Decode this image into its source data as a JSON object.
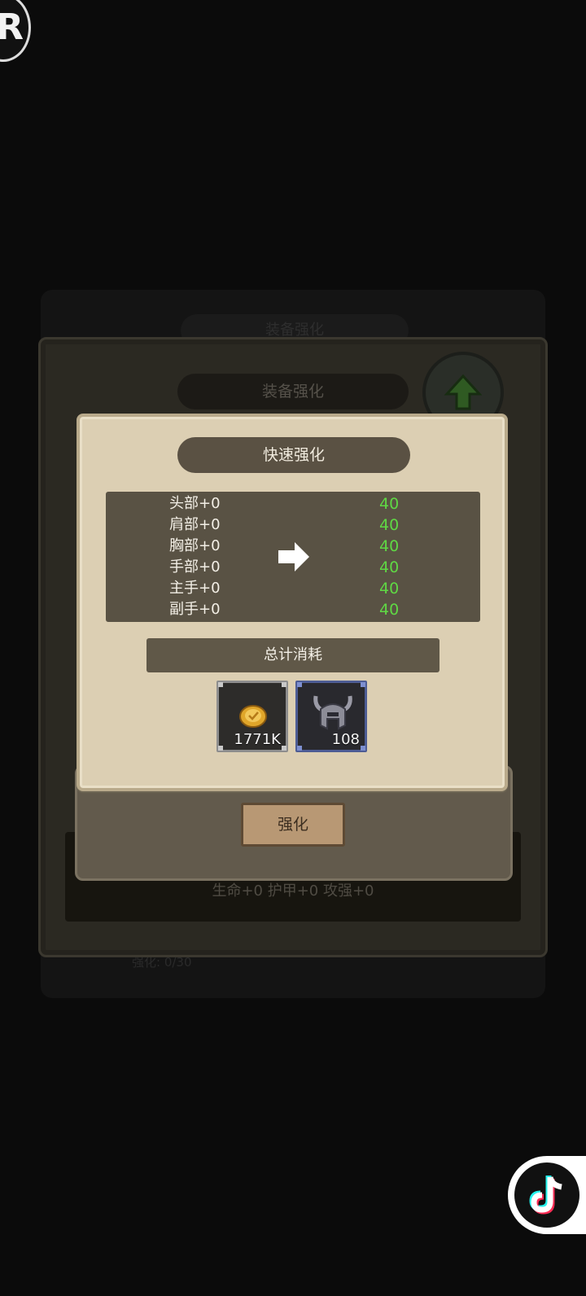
{
  "background_panel": {
    "title": "装备强化",
    "footer_text": "强化: 0/30"
  },
  "outer_panel": {
    "title": "装备强化",
    "stats": "生命+0  护甲+0  攻强+0"
  },
  "dialog": {
    "title": "快速强化",
    "items": [
      {
        "label": "头部+0",
        "value": "40"
      },
      {
        "label": "肩部+0",
        "value": "40"
      },
      {
        "label": "胸部+0",
        "value": "40"
      },
      {
        "label": "手部+0",
        "value": "40"
      },
      {
        "label": "主手+0",
        "value": "40"
      },
      {
        "label": "副手+0",
        "value": "40"
      }
    ],
    "total_label": "总计消耗",
    "costs": [
      {
        "icon": "gold-coin-icon",
        "amount": "1771K"
      },
      {
        "icon": "horned-helmet-icon",
        "amount": "108"
      }
    ],
    "confirm_label": "强化"
  },
  "overlay": {
    "logo_letter": "R"
  },
  "colors": {
    "value_green": "#5fd844",
    "parchment": "#dccfb3",
    "title_bar": "#5a5143"
  }
}
